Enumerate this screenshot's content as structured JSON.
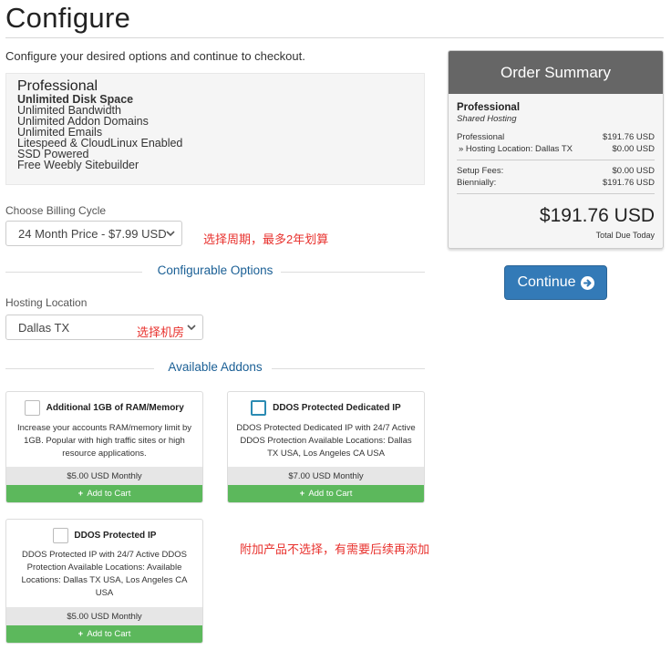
{
  "page": {
    "title": "Configure",
    "intro": "Configure your desired options and continue to checkout."
  },
  "product": {
    "name": "Professional",
    "features": [
      "Unlimited Disk Space",
      "Unlimited Bandwidth",
      "Unlimited Addon Domains",
      "Unlimited Emails",
      "Litespeed & CloudLinux Enabled",
      "SSD Powered",
      "Free Weebly Sitebuilder"
    ]
  },
  "billing": {
    "label": "Choose Billing Cycle",
    "selected": "24 Month Price - $7.99 USD",
    "note": "选择周期，最多2年划算"
  },
  "configurable": {
    "heading": "Configurable Options",
    "location_label": "Hosting Location",
    "location_selected": "Dallas TX",
    "note": "选择机房"
  },
  "addons": {
    "heading": "Available Addons",
    "note": "附加产品不选择，有需要后续再添加",
    "cart_label": "Add to Cart",
    "items": [
      {
        "name": "Additional 1GB of RAM/Memory",
        "desc": "Increase your accounts RAM/memory limit by 1GB. Popular with high traffic sites or high resource applications.",
        "price": "$5.00 USD Monthly"
      },
      {
        "name": "DDOS Protected Dedicated IP",
        "desc": "DDOS Protected Dedicated IP with 24/7 Active DDOS Protection Available Locations: Dallas TX USA, Los Angeles CA USA",
        "price": "$7.00 USD Monthly"
      },
      {
        "name": "DDOS Protected IP",
        "desc": "DDOS Protected IP with 24/7 Active DDOS Protection Available Locations: Available Locations: Dallas TX USA, Los Angeles CA USA",
        "price": "$5.00 USD Monthly"
      }
    ]
  },
  "summary": {
    "title": "Order Summary",
    "product_name": "Professional",
    "product_group": "Shared Hosting",
    "lines": [
      {
        "label": "Professional",
        "value": "$191.76 USD"
      },
      {
        "label": "» Hosting Location: Dallas TX",
        "value": "$0.00 USD"
      }
    ],
    "setup_label": "Setup Fees:",
    "setup_value": "$0.00 USD",
    "cycle_label": "Biennially:",
    "cycle_value": "$191.76 USD",
    "total": "$191.76 USD",
    "total_label": "Total Due Today"
  },
  "actions": {
    "continue_label": "Continue"
  },
  "colors": {
    "accent": "#337ab7",
    "cart_green": "#5cb85c",
    "note_red": "#e8322e",
    "section_blue": "#1a5f95",
    "summary_header": "#666666"
  },
  "icons": {
    "select_arrow": "chevron-down-icon",
    "continue_arrow": "circle-arrow-right-icon",
    "cart_plus": "plus-icon"
  }
}
